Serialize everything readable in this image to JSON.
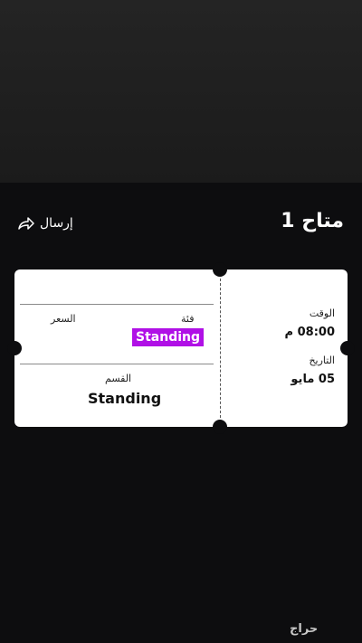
{
  "header": {
    "title": "متاح 1",
    "send_label": "إرسال"
  },
  "ticket": {
    "price_label": "السعر",
    "category_label": "فئة",
    "category_value": "Standing",
    "section_label": "القسم",
    "section_value": "Standing",
    "time_label": "الوقت",
    "time_value": "08:00 م",
    "date_label": "التاريخ",
    "date_value": "05 مايو"
  },
  "footer": {
    "logo_text": "حراج"
  },
  "colors": {
    "panel_bg": "#0d0d0f",
    "ticket_bg": "#ffffff",
    "category_badge": "#b010e6"
  },
  "icons": {
    "send": "share-arrow-icon"
  }
}
